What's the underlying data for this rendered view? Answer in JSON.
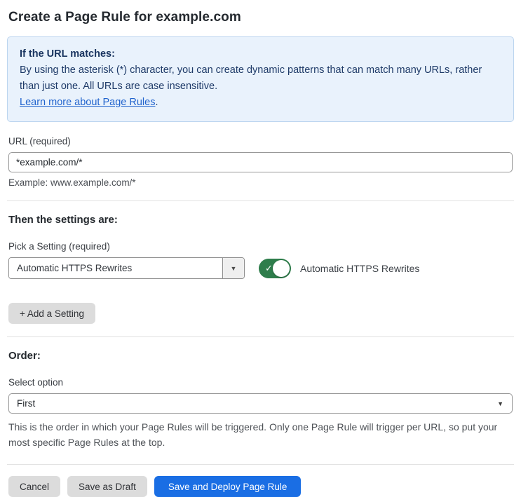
{
  "page": {
    "title": "Create a Page Rule for example.com"
  },
  "info_box": {
    "heading": "If the URL matches:",
    "body": "By using the asterisk (*) character, you can create dynamic patterns that can match many URLs, rather than just one. All URLs are case insensitive.",
    "link_label": "Learn more about Page Rules",
    "link_suffix": "."
  },
  "url_field": {
    "label": "URL (required)",
    "value": "*example.com/*",
    "helper": "Example: www.example.com/*"
  },
  "settings_section": {
    "heading": "Then the settings are:",
    "picker_label": "Pick a Setting (required)",
    "picker_value": "Automatic HTTPS Rewrites",
    "picker_chevron": "▼",
    "toggle": {
      "state": "on",
      "check_glyph": "✓",
      "label": "Automatic HTTPS Rewrites"
    },
    "add_button_label": "+ Add a Setting"
  },
  "order_section": {
    "heading": "Order:",
    "select_label": "Select option",
    "select_value": "First",
    "select_chevron": "▼",
    "helper": "This is the order in which your Page Rules will be triggered. Only one Page Rule will trigger per URL, so put your most specific Page Rules at the top."
  },
  "footer": {
    "cancel_label": "Cancel",
    "save_draft_label": "Save as Draft",
    "save_deploy_label": "Save and Deploy Page Rule"
  },
  "colors": {
    "accent_blue": "#1a6ee4",
    "toggle_green": "#2e7d4b",
    "info_box_bg": "#e9f2fc",
    "info_box_border": "#bcd5ef",
    "info_text": "#1e3a68",
    "link_blue": "#2063cd",
    "gray_button_bg": "#dcdcdc",
    "divider": "#e2e2e2"
  }
}
